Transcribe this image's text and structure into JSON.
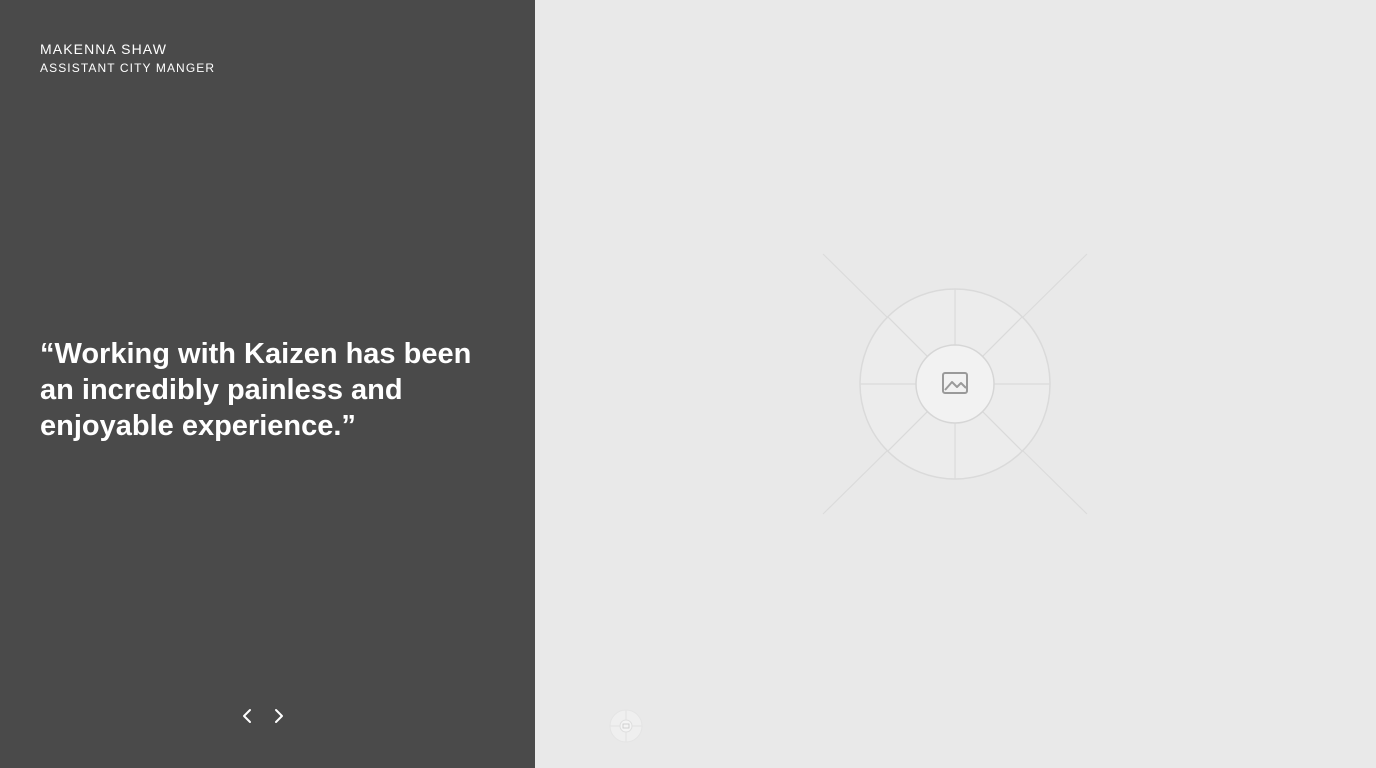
{
  "testimonial": {
    "name": "MAKENNA SHAW",
    "role": "ASSISTANT CITY MANGER",
    "quote": "“Working with Kaizen has been an incredibly painless and enjoyable experience.”"
  },
  "navigation": {
    "prev_icon": "chevron-left-icon",
    "next_icon": "chevron-right-icon"
  },
  "media": {
    "placeholder_icon": "image-icon"
  },
  "colors": {
    "left_panel_bg": "#4a4a4a",
    "right_panel_bg": "#e9e9e9",
    "text": "#ffffff"
  }
}
